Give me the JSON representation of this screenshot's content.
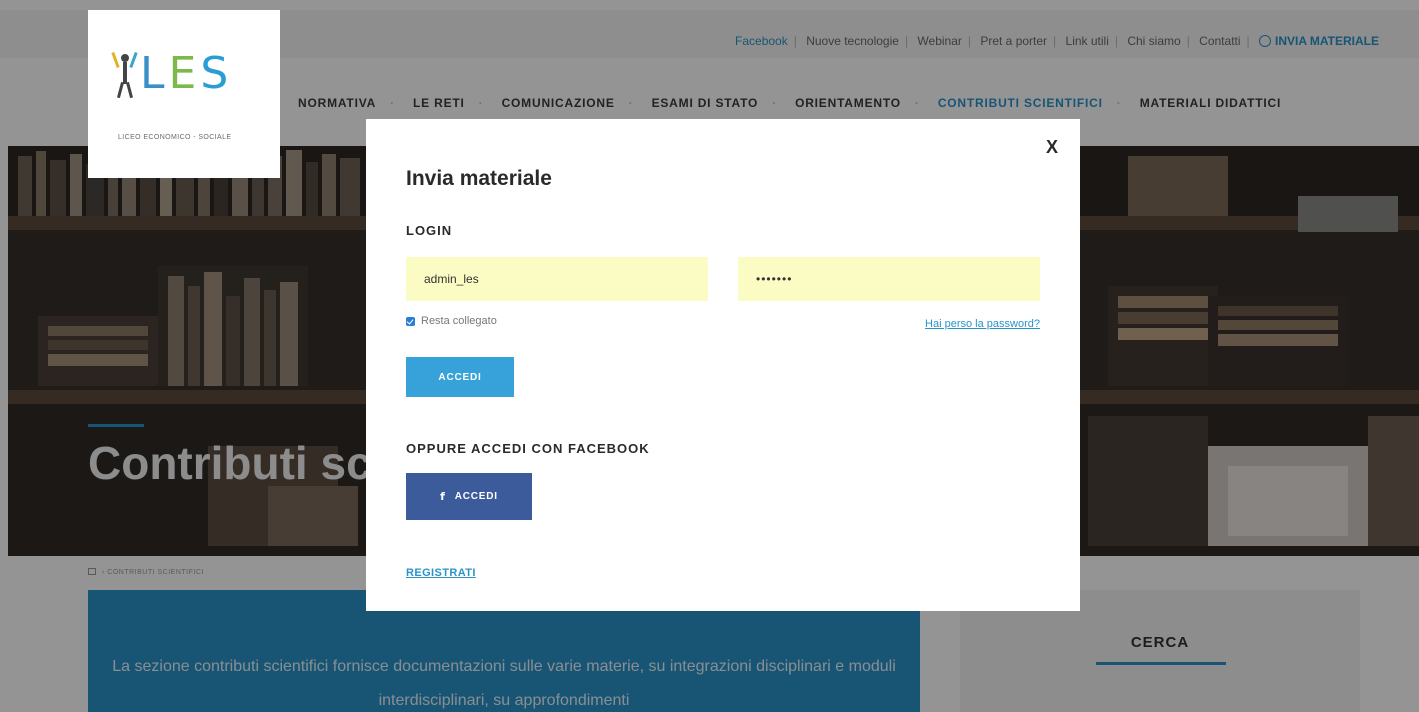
{
  "top_links": {
    "items": [
      "Facebook",
      "Nuove tecnologie",
      "Webinar",
      "Pret a porter",
      "Link utili",
      "Chi siamo",
      "Contatti"
    ],
    "invia_label": "INVIA MATERIALE"
  },
  "logo": {
    "text": "LES",
    "subtitle": "LICEO ECONOMICO - SOCIALE"
  },
  "nav": {
    "items": [
      "NORMATIVA",
      "LE RETI",
      "COMUNICAZIONE",
      "ESAMI DI STATO",
      "ORIENTAMENTO",
      "CONTRIBUTI SCIENTIFICI",
      "MATERIALI DIDATTICI"
    ],
    "active_index": 5
  },
  "hero": {
    "title": "Contributi scientifici"
  },
  "breadcrumb": {
    "current": "CONTRIBUTI SCIENTIFICI"
  },
  "intro": {
    "text": "La sezione contributi scientifici fornisce documentazioni sulle varie materie, su integrazioni disciplinari e moduli interdisciplinari, su approfondimenti"
  },
  "sidebar": {
    "cerca_title": "CERCA"
  },
  "modal": {
    "close_label": "X",
    "title": "Invia materiale",
    "login_heading": "LOGIN",
    "username_value": "admin_les",
    "password_value": "•••••••",
    "remember_label": "Resta collegato",
    "remember_checked": true,
    "lost_password_label": "Hai perso la password?",
    "login_button": "ACCEDI",
    "facebook_heading": "OPPURE ACCEDI CON FACEBOOK",
    "facebook_icon": "f",
    "facebook_button": "ACCEDI",
    "register_label": "REGISTRATI"
  },
  "colors": {
    "accent": "#2a93c9",
    "facebook": "#3b5b9a",
    "field_bg": "#fbfcc3"
  }
}
